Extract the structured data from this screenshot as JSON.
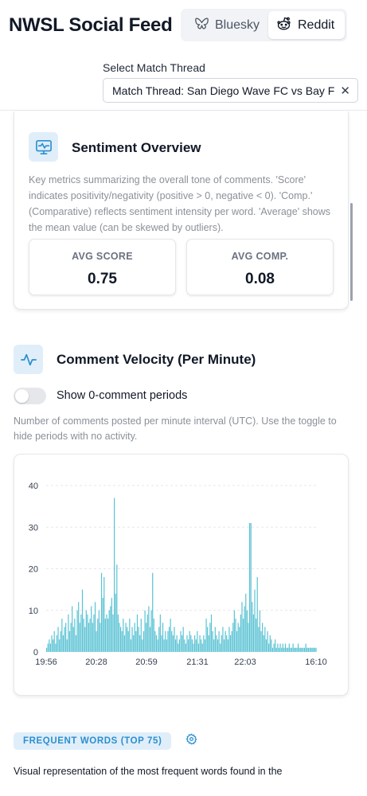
{
  "header": {
    "title": "NWSL Social Feed",
    "platforms": [
      {
        "label": "Bluesky",
        "icon": "butterfly-icon",
        "selected": false
      },
      {
        "label": "Reddit",
        "icon": "reddit-icon",
        "selected": true
      }
    ],
    "select_label": "Select Match Thread",
    "selected_thread": "Match Thread: San Diego Wave FC vs Bay FC |"
  },
  "sentiment": {
    "title": "Sentiment Overview",
    "description": "Key metrics summarizing the overall tone of comments. 'Score' indicates positivity/negativity (positive > 0, negative < 0). 'Comp.' (Comparative) reflects sentiment intensity per word. 'Average' shows the mean value (can be skewed by outliers).",
    "metrics": [
      {
        "label": "AVG SCORE",
        "value": "0.75"
      },
      {
        "label": "AVG COMP.",
        "value": "0.08"
      }
    ]
  },
  "velocity": {
    "title": "Comment Velocity (Per Minute)",
    "toggle_label": "Show 0-comment periods",
    "toggle_on": false,
    "description": "Number of comments posted per minute interval (UTC). Use the toggle to hide periods with no activity."
  },
  "chart_data": {
    "type": "bar",
    "title": "",
    "xlabel": "",
    "ylabel": "",
    "ylim": [
      0,
      40
    ],
    "y_ticks": [
      0,
      10,
      20,
      30,
      40
    ],
    "x_tick_labels": [
      "19:56",
      "20:28",
      "20:59",
      "21:31",
      "22:03",
      "16:10"
    ],
    "grid": true,
    "bar_color": "#5bc3d4",
    "values": [
      1,
      2,
      3,
      2,
      4,
      3,
      5,
      2,
      4,
      6,
      3,
      5,
      8,
      4,
      6,
      7,
      3,
      9,
      5,
      7,
      11,
      6,
      8,
      4,
      10,
      12,
      7,
      9,
      15,
      8,
      6,
      10,
      9,
      7,
      8,
      11,
      7,
      9,
      12,
      5,
      8,
      10,
      7,
      19,
      13,
      18,
      8,
      9,
      8,
      10,
      11,
      13,
      9,
      37,
      14,
      21,
      9,
      7,
      6,
      5,
      8,
      4,
      7,
      6,
      5,
      8,
      3,
      6,
      4,
      7,
      5,
      9,
      6,
      4,
      8,
      3,
      5,
      10,
      7,
      9,
      11,
      6,
      10,
      19,
      8,
      5,
      4,
      3,
      6,
      9,
      4,
      7,
      3,
      5,
      3,
      5,
      6,
      8,
      5,
      4,
      6,
      3,
      4,
      2,
      3,
      5,
      4,
      6,
      3,
      2,
      4,
      3,
      5,
      4,
      3,
      2,
      4,
      3,
      5,
      2,
      4,
      3,
      2,
      4,
      3,
      8,
      6,
      4,
      7,
      9,
      5,
      3,
      6,
      4,
      3,
      5,
      2,
      4,
      6,
      3,
      5,
      4,
      3,
      6,
      4,
      5,
      7,
      10,
      8,
      5,
      7,
      6,
      9,
      12,
      8,
      11,
      14,
      10,
      7,
      31,
      31,
      12,
      9,
      15,
      8,
      18,
      6,
      10,
      5,
      7,
      4,
      6,
      3,
      5,
      2,
      4,
      3,
      1,
      2,
      3,
      1,
      2,
      1,
      2,
      1,
      2,
      1,
      2,
      1,
      1,
      2,
      1,
      1,
      2,
      1,
      1,
      1,
      2,
      1,
      1,
      1,
      1,
      1,
      2,
      1,
      1,
      1,
      1,
      1,
      1,
      1,
      1
    ]
  },
  "frequent_words": {
    "badge": "FREQUENT WORDS (TOP 75)",
    "description": "Visual representation of the most frequent words found in the"
  }
}
